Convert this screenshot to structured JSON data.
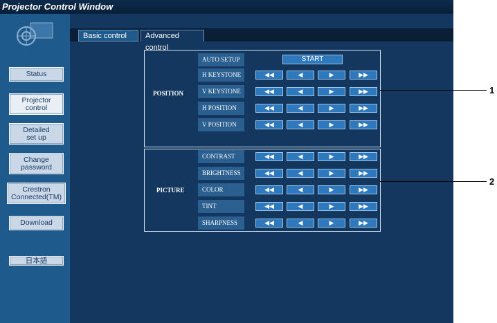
{
  "window": {
    "title": "Projector Control Window"
  },
  "sidebar": {
    "items": [
      {
        "label": "Status"
      },
      {
        "label": "Projector\ncontrol",
        "active": true
      },
      {
        "label": "Detailed\nset up"
      },
      {
        "label": "Change\npassword"
      },
      {
        "label": "Crestron\nConnected(TM)"
      },
      {
        "label": "Download"
      },
      {
        "label": "日本語"
      }
    ]
  },
  "tabs": [
    {
      "label": "Basic control"
    },
    {
      "label": "Advanced control",
      "active": true
    }
  ],
  "position_group": {
    "label": "POSITION",
    "auto_setup": {
      "label": "AUTO SETUP",
      "button": "START"
    },
    "rows": [
      {
        "label": "H KEYSTONE"
      },
      {
        "label": "V KEYSTONE"
      },
      {
        "label": "H POSITION"
      },
      {
        "label": "V POSITION"
      }
    ]
  },
  "picture_group": {
    "label": "PICTURE",
    "rows": [
      {
        "label": "CONTRAST"
      },
      {
        "label": "BRIGHTNESS"
      },
      {
        "label": "COLOR"
      },
      {
        "label": "TINT"
      },
      {
        "label": "SHARPNESS"
      }
    ]
  },
  "controls": {
    "fast_left": "◀◀",
    "left": "◀",
    "right": "▶",
    "fast_right": "▶▶"
  },
  "callouts": {
    "one": "1",
    "two": "2"
  },
  "colors": {
    "window_bg": "#13375f",
    "sidebar_bg": "#1f5a8c",
    "button_blue": "#2e78bd"
  }
}
